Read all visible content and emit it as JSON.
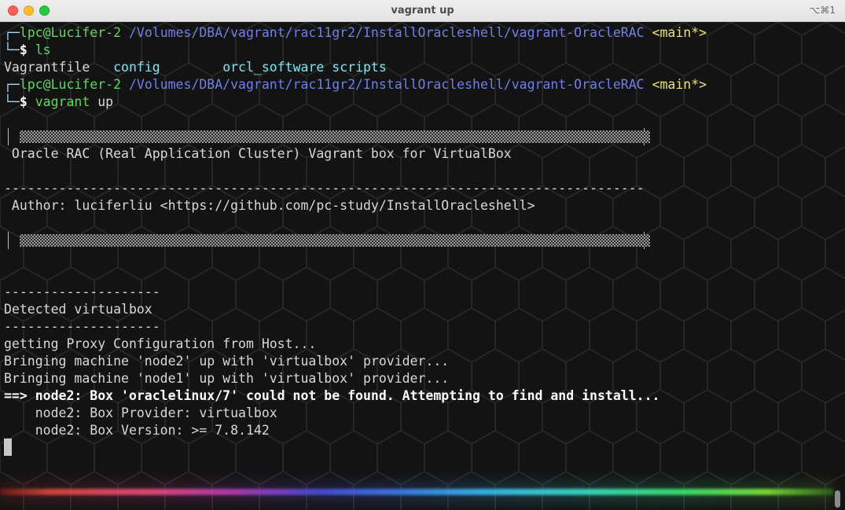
{
  "window": {
    "title": "vagrant up",
    "shortcut": "⌥⌘1"
  },
  "terminal": {
    "prompt1": {
      "corner_top": "┌─",
      "user": "lpc@Lucifer-2",
      "path": "/Volumes/DBA/vagrant/rac11gr2/InstallOracleshell/vagrant-OracleRAC",
      "branch": "<main*>",
      "corner_bottom": "└─",
      "symbol": "$",
      "command": "ls"
    },
    "ls_output": {
      "file1": "Vagrantfile",
      "dir1": "config",
      "dir2": "orcl_software",
      "dir3": "scripts"
    },
    "prompt2": {
      "corner_top": "┌─",
      "user": "lpc@Lucifer-2",
      "path": "/Volumes/DBA/vagrant/rac11gr2/InstallOracleshell/vagrant-OracleRAC",
      "branch": "<main*>",
      "corner_bottom": "└─",
      "symbol": "$",
      "command": "vagrant",
      "arg": "up"
    },
    "banner_title": " Oracle RAC (Real Application Cluster) Vagrant box for VirtualBox",
    "dash_line": "----------------------------------------------------------------------------------",
    "author_line": " Author: luciferliu <https://github.com/pc-study/InstallOracleshell>",
    "short_dash": "--------------------",
    "detected": "Detected virtualbox",
    "proxy": "getting Proxy Configuration from Host...",
    "bring_node2": "Bringing machine 'node2' up with 'virtualbox' provider...",
    "bring_node1": "Bringing machine 'node1' up with 'virtualbox' provider...",
    "box_missing": "==> node2: Box 'oraclelinux/7' could not be found. Attempting to find and install...",
    "box_provider": "    node2: Box Provider: virtualbox",
    "box_version": "    node2: Box Version: >= 7.8.142"
  }
}
